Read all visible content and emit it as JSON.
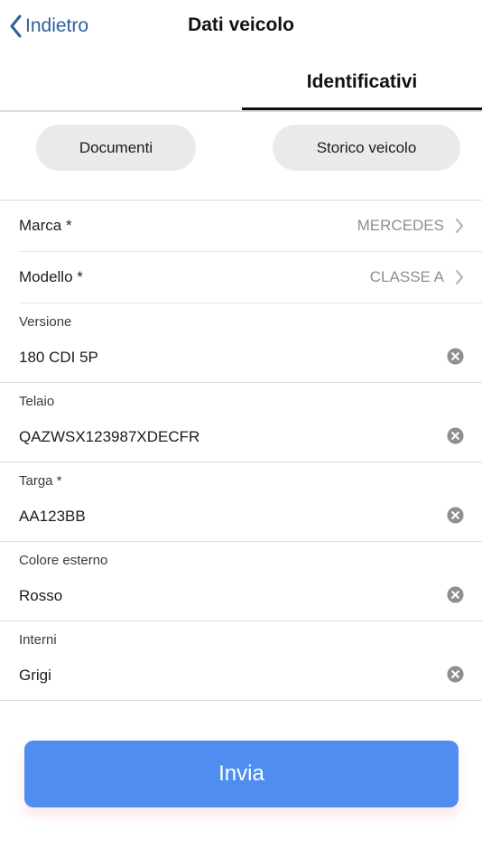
{
  "header": {
    "back_label": "Indietro",
    "title": "Dati veicolo"
  },
  "tabs": {
    "active_label": "Identificativi"
  },
  "actions": {
    "documents_label": "Documenti",
    "history_label": "Storico veicolo"
  },
  "fields": {
    "marca": {
      "label": "Marca *",
      "value": "MERCEDES"
    },
    "modello": {
      "label": "Modello *",
      "value": "CLASSE A"
    },
    "versione": {
      "label": "Versione",
      "value": "180 CDI 5P"
    },
    "telaio": {
      "label": "Telaio",
      "value": "QAZWSX123987XDECFR"
    },
    "targa": {
      "label": "Targa *",
      "value": "AA123BB"
    },
    "colore": {
      "label": "Colore esterno",
      "value": "Rosso"
    },
    "interni": {
      "label": "Interni",
      "value": "Grigi"
    }
  },
  "submit": {
    "label": "Invia"
  },
  "icons": {
    "back": "chevron-left-icon",
    "select": "chevron-right-icon",
    "clear": "clear-circle-icon"
  },
  "colors": {
    "accent": "#4f8ef0",
    "back_link": "#2f5f9e",
    "pill_bg": "#eaeaea"
  }
}
